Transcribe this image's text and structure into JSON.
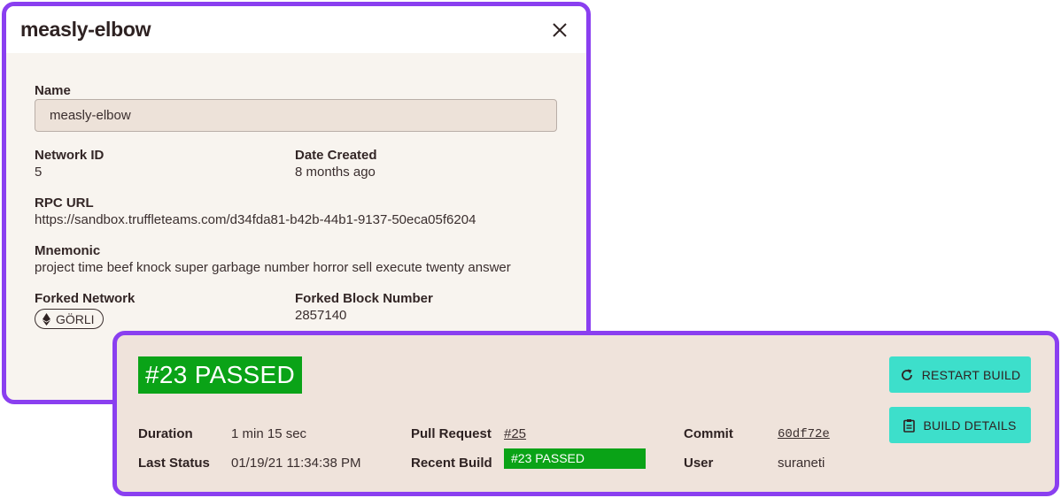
{
  "modal": {
    "title": "measly-elbow",
    "close_icon": "close-icon",
    "name_label": "Name",
    "name_value": "measly-elbow",
    "network_id_label": "Network ID",
    "network_id_value": "5",
    "date_created_label": "Date Created",
    "date_created_value": "8 months ago",
    "rpc_url_label": "RPC URL",
    "rpc_url_value": "https://sandbox.truffleteams.com/d34fda81-b42b-44b1-9137-50eca05f6204",
    "mnemonic_label": "Mnemonic",
    "mnemonic_value": "project time beef knock super garbage number horror sell execute twenty answer",
    "forked_network_label": "Forked Network",
    "forked_network_value": "GÖRLI",
    "forked_network_icon": "ethereum-icon",
    "forked_block_label": "Forked Block Number",
    "forked_block_value": "2857140"
  },
  "build": {
    "status_title": "#23 PASSED",
    "duration_label": "Duration",
    "duration_value": "1 min 15 sec",
    "last_status_label": "Last Status",
    "last_status_value": "01/19/21 11:34:38 PM",
    "pull_request_label": "Pull Request",
    "pull_request_value": "#25",
    "recent_build_label": "Recent Build",
    "recent_build_value": "#23 PASSED",
    "commit_label": "Commit",
    "commit_value": "60df72e",
    "user_label": "User",
    "user_value": "suraneti",
    "restart_label": "RESTART BUILD",
    "restart_icon": "refresh-icon",
    "details_label": "BUILD DETAILS",
    "details_icon": "clipboard-icon"
  },
  "colors": {
    "accent_border": "#8a3ff0",
    "passed_green": "#0aa317",
    "button_teal": "#3ddfcb"
  }
}
